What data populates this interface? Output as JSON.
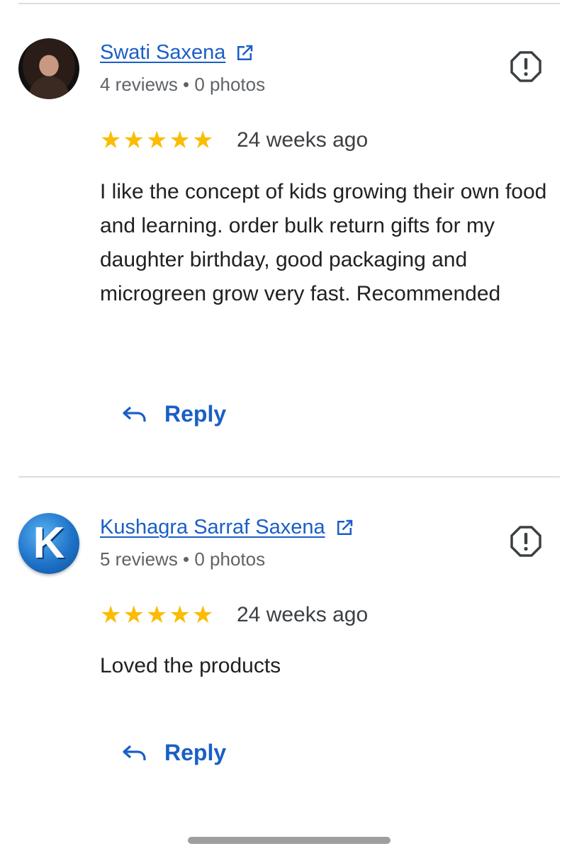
{
  "reviews": [
    {
      "name": "Swati Saxena",
      "meta": "4 reviews • 0 photos",
      "rating": 5,
      "stars": [
        "★",
        "★",
        "★",
        "★",
        "★"
      ],
      "time": "24 weeks ago",
      "text": "I like the concept of kids growing their own food and learning. order bulk return gifts for my daughter birthday, good packaging and microgreen grow very fast. Recommended",
      "reply_label": "Reply",
      "avatar": "profile-photo"
    },
    {
      "name": "Kushagra Sarraf Saxena",
      "meta": "5 reviews • 0 photos",
      "rating": 5,
      "stars": [
        "★",
        "★",
        "★",
        "★",
        "★"
      ],
      "time": "24 weeks ago",
      "text": "Loved the products",
      "reply_label": "Reply",
      "avatar": "letter-avatar",
      "avatar_letter": "K"
    }
  ],
  "colors": {
    "link": "#1a5fc7",
    "star": "#fbbc04",
    "meta": "#5f6368"
  },
  "icons": [
    "external-link-icon",
    "report-flag-icon",
    "star-icon",
    "reply-arrow-icon"
  ]
}
